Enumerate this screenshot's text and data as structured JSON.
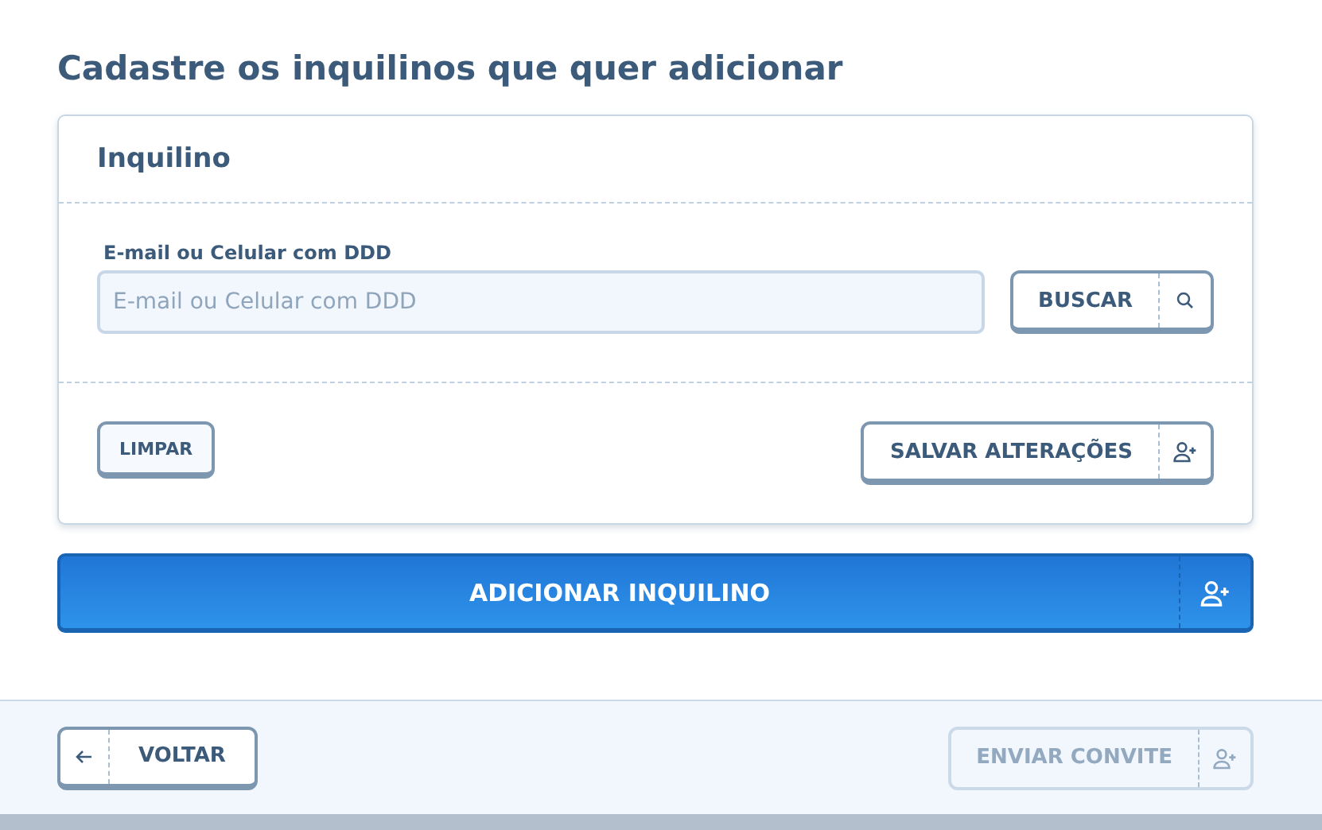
{
  "title": "Cadastre os inquilinos que quer adicionar",
  "card": {
    "title": "Inquilino",
    "field": {
      "label": "E-mail ou Celular com DDD",
      "placeholder": "E-mail ou Celular com DDD"
    },
    "search_button": {
      "label": "BUSCAR"
    },
    "clear_button": {
      "label": "LIMPAR"
    },
    "save_button": {
      "label": "SALVAR ALTERAÇÕES"
    }
  },
  "add_button": {
    "label": "ADICIONAR INQUILINO"
  },
  "footer": {
    "back_button": {
      "label": "VOLTAR",
      "disabled": false
    },
    "invite_button": {
      "label": "ENVIAR CONVITE",
      "disabled": true
    }
  }
}
